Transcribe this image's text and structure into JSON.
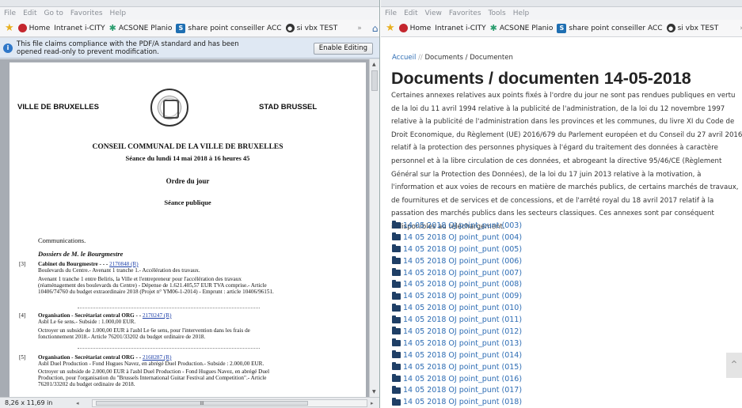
{
  "left": {
    "menu": [
      "File",
      "Edit",
      "Go to",
      "Favorites",
      "Help"
    ],
    "favorites": {
      "home": "Home",
      "intranet": "Intranet i-CITY",
      "acsone": "ACSONE Planio",
      "sharepoint": "share point conseiller ACC",
      "vbx": "si vbx TEST",
      "more": "»"
    },
    "infobar": {
      "text": "This file claims compliance with the PDF/A standard and has been opened read-only to prevent modification.",
      "button": "Enable Editing"
    },
    "pdf": {
      "header_left": "VILLE DE BRUXELLES",
      "header_right": "STAD BRUSSEL",
      "council": "CONSEIL COMMUNAL DE LA VILLE DE BRUXELLES",
      "session_date": "Séance du lundi 14 mai 2018 à 16 heures 45",
      "agenda": "Ordre du jour",
      "public": "Séance publique",
      "communications": "Communications.",
      "dossiers": "Dossiers de M. le Bourgmestre",
      "items": [
        {
          "num": "[3]",
          "head": "Cabinet du Bourgmestre - - - ",
          "ref": "2170848 (R)",
          "lines": [
            "Boulevards du Centre.- Avenant 1 tranche 1.- Accélération des travaux.",
            "Avenant 1 tranche 1 entre Beliris, la Ville et l'entrepreneur pour l'accélération des travaux",
            "(réaménagement des boulevards du Centre) - Dépense de 1.621.405,57 EUR TVA comprise.- Article",
            "10406/74760 du budget extraordinaire 2018 (Projet n° YM06-1-2014) - Emprunt : article 10406/96151."
          ]
        },
        {
          "num": "[4]",
          "head": "Organisation - Secrétariat central ORG - - ",
          "ref": "2170247 (R)",
          "lines": [
            "Asbl Le 6e sens.- Subside : 1.000,00 EUR.",
            "Octroyer un subside de 1.000,00 EUR à l'asbl Le 6e sens, pour l'intervention dans les frais de",
            "fonctionnement 2018.- Article 76201/33202 du budget ordinaire de 2018."
          ]
        },
        {
          "num": "[5]",
          "head": "Organisation - Secrétariat central ORG - - ",
          "ref": "2168287 (R)",
          "lines": [
            "Asbl Duel Production - Fond Hugues Navez, en abrégé Duel Production.- Subside : 2.000,00 EUR.",
            "Octroyer un subside de 2.000,00 EUR à l'asbl Duel Production - Fond Hugues Navez, en abrégé Duel",
            "Production, pour l'organisation du \"Brussels International Guitar Festival and Competition\".- Article",
            "76201/33202 du budget ordinaire de 2018."
          ]
        }
      ]
    },
    "status": {
      "page_size": "8,26 x 11,69 in",
      "grip": "III"
    }
  },
  "right": {
    "menu": [
      "File",
      "Edit",
      "View",
      "Favorites",
      "Tools",
      "Help"
    ],
    "favorites": {
      "home": "Home",
      "intranet": "Intranet i-CITY",
      "acsone": "ACSONE Planio",
      "sharepoint": "share point conseiller ACC",
      "vbx": "si vbx TEST",
      "more": "»"
    },
    "breadcrumb": {
      "home": "Accueil",
      "sep": "//",
      "current": "Documents / Documenten"
    },
    "title": "Documents / documenten 14-05-2018",
    "paragraph": "Certaines annexes relatives aux points fixés à l'ordre du jour ne sont pas rendues publiques en vertu de la loi du 11 avril 1994 relative à la publicité de l'administration, de la loi du 12 novembre 1997 relative à la publicité de l'administration dans les provinces et les communes, du livre XI du Code de Droit Economique, du Règlement (UE) 2016/679 du Parlement européen et du Conseil du 27 avril 2016 relatif à la protection des personnes physiques à l'égard du traitement des données à caractère personnel et à la libre circulation de ces données, et abrogeant la directive 95/46/CE (Règlement Général sur la Protection des Données), de la loi du 17 juin 2013 relative à la motivation, à l'information et aux voies de recours en matière de marchés publics, de certains marchés de travaux, de fournitures et de services et de concessions, et de l'arrêté royal du 18 avril 2017 relatif à la passation des marchés publics dans les secteurs classiques. Ces annexes sont par conséquent indisponibles au téléchargement.",
    "documents": [
      "14 05 2018 OJ point_punt (003)",
      "14 05 2018 OJ point_punt (004)",
      "14 05 2018 OJ point_punt (005)",
      "14 05 2018 OJ point_punt (006)",
      "14 05 2018 OJ point_punt (007)",
      "14 05 2018 OJ point_punt (008)",
      "14 05 2018 OJ point_punt (009)",
      "14 05 2018 OJ point_punt (010)",
      "14 05 2018 OJ point_punt (011)",
      "14 05 2018 OJ point_punt (012)",
      "14 05 2018 OJ point_punt (013)",
      "14 05 2018 OJ point_punt (014)",
      "14 05 2018 OJ point_punt (015)",
      "14 05 2018 OJ point_punt (016)",
      "14 05 2018 OJ point_punt (017)",
      "14 05 2018 OJ point_punt (018)"
    ]
  }
}
